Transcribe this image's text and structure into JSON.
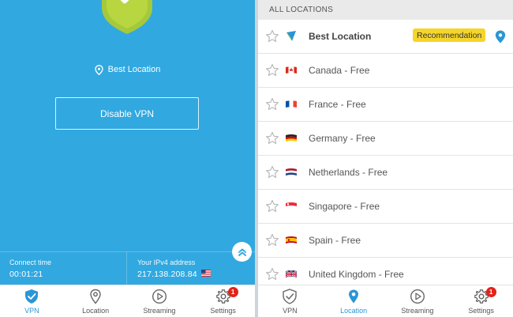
{
  "vpn_screen": {
    "best_location_label": "Best Location",
    "disable_button_label": "Disable VPN",
    "connect_time_label": "Connect time",
    "connect_time_value": "00:01:21",
    "ip_label": "Your IPv4 address",
    "ip_value": "217.138.208.84",
    "ip_country_flag": "us-flag-icon"
  },
  "locations_screen": {
    "header": "ALL LOCATIONS",
    "items": [
      {
        "name": "Best Location",
        "badge": "Recommendation",
        "flag": "best-location-icon"
      },
      {
        "name": "Canada - Free",
        "flag": "canada-flag-icon"
      },
      {
        "name": "France - Free",
        "flag": "france-flag-icon"
      },
      {
        "name": "Germany - Free",
        "flag": "germany-flag-icon"
      },
      {
        "name": "Netherlands - Free",
        "flag": "netherlands-flag-icon"
      },
      {
        "name": "Singapore - Free",
        "flag": "singapore-flag-icon"
      },
      {
        "name": "Spain - Free",
        "flag": "spain-flag-icon"
      },
      {
        "name": "United Kingdom - Free",
        "flag": "uk-flag-icon"
      }
    ]
  },
  "nav": {
    "vpn": "VPN",
    "location": "Location",
    "streaming": "Streaming",
    "settings": "Settings",
    "settings_badge": "1"
  },
  "colors": {
    "primary_blue": "#31a8e0",
    "active_nav": "#2b96d5",
    "shield_green": "#a5c93a",
    "recommendation": "#f5d52a",
    "badge_red": "#e2231a"
  }
}
